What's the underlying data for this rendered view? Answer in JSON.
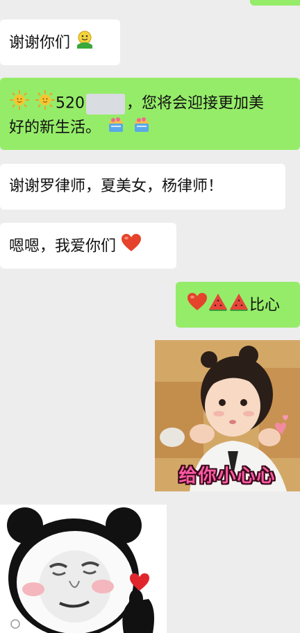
{
  "messages": [
    {
      "id": "m1",
      "side": "in",
      "text": "谢谢你们",
      "emoji_after": "smiley-hug-icon"
    },
    {
      "id": "m2",
      "side": "out",
      "text_line1_suffix": "，您将会迎接更加美",
      "number": "520",
      "text_line2": "好的新生活。",
      "emojis_start": [
        "sun-icon",
        "sun-icon"
      ],
      "emojis_end": [
        "cake-icon",
        "cake-icon"
      ]
    },
    {
      "id": "m3",
      "side": "in",
      "text": "谢谢罗律师，夏美女，杨律师！"
    },
    {
      "id": "m4",
      "side": "in",
      "text": "嗯嗯，我爱你们",
      "emoji_after": "heart-icon"
    },
    {
      "id": "m5",
      "side": "out",
      "text": "比心",
      "emojis_start": [
        "heart-icon",
        "watermelon-icon",
        "watermelon-icon"
      ]
    }
  ],
  "stickers": [
    {
      "id": "s1",
      "caption": "给你小心心",
      "icon": "girl-finger-heart-sticker"
    },
    {
      "id": "s2",
      "icon": "panda-finger-heart-sticker"
    }
  ],
  "colors": {
    "background": "#ededed",
    "incoming": "#ffffff",
    "outgoing": "#95ec69",
    "heart": "#e5432b"
  }
}
